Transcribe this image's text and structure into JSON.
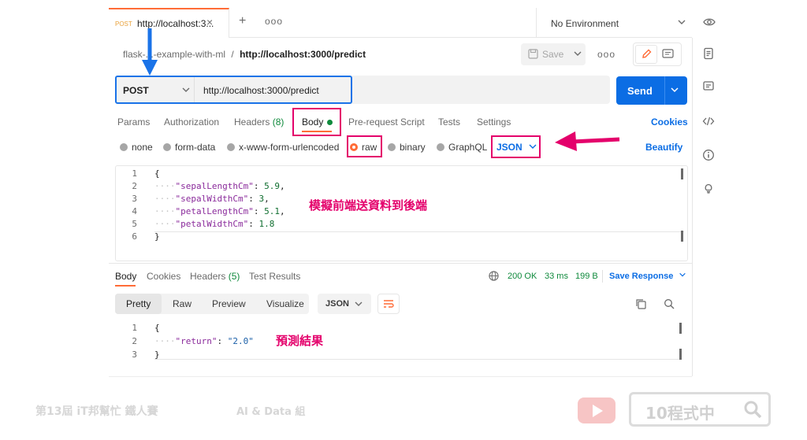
{
  "colors": {
    "accent": "#ff6c37",
    "link": "#0b6de4",
    "annotation": "#e4006b",
    "highlight_blue": "#1a73e8",
    "success": "#0f8a3c"
  },
  "tabbar": {
    "method": "POST",
    "url": "http://localhost:3...",
    "close": "×",
    "plus": "+",
    "more": "ooo"
  },
  "environment": {
    "label": "No Environment"
  },
  "breadcrumb": {
    "collection": "flask-...-example-with-ml",
    "separator": "/",
    "request": "http://localhost:3000/predict"
  },
  "toolbar": {
    "save_label": "Save",
    "more": "ooo"
  },
  "request": {
    "method": "POST",
    "url": "http://localhost:3000/predict",
    "send_label": "Send"
  },
  "request_tabs": {
    "params": "Params",
    "authorization": "Authorization",
    "headers": "Headers",
    "headers_count": "(8)",
    "body": "Body",
    "prerequest": "Pre-request Script",
    "tests": "Tests",
    "settings": "Settings",
    "cookies": "Cookies"
  },
  "body_types": {
    "none": "none",
    "form_data": "form-data",
    "urlencoded": "x-www-form-urlencoded",
    "raw": "raw",
    "binary": "binary",
    "graphql": "GraphQL",
    "format": "JSON",
    "beautify": "Beautify"
  },
  "request_body": {
    "lines": [
      {
        "n": "1",
        "text": "{"
      },
      {
        "n": "2",
        "key": "\"sepalLengthCm\"",
        "value": "5.9",
        "sep": ": ",
        "end": ","
      },
      {
        "n": "3",
        "key": "\"sepalWidthCm\"",
        "value": "3",
        "sep": ": ",
        "end": ","
      },
      {
        "n": "4",
        "key": "\"petalLengthCm\"",
        "value": "5.1",
        "sep": ": ",
        "end": ","
      },
      {
        "n": "5",
        "key": "\"petalWidthCm\"",
        "value": "1.8",
        "sep": ": ",
        "end": ""
      },
      {
        "n": "6",
        "text": "}"
      }
    ]
  },
  "annotations": {
    "simulate": "模擬前端送資料到後端",
    "result": "預測結果"
  },
  "response_tabs": {
    "body": "Body",
    "cookies": "Cookies",
    "headers": "Headers",
    "headers_count": "(5)",
    "test_results": "Test Results"
  },
  "response_meta": {
    "status": "200 OK",
    "time": "33 ms",
    "size": "199 B",
    "save_response": "Save Response"
  },
  "response_formats": {
    "pretty": "Pretty",
    "raw": "Raw",
    "preview": "Preview",
    "visualize": "Visualize",
    "format": "JSON"
  },
  "response_body": {
    "lines": [
      {
        "n": "1",
        "text": "{"
      },
      {
        "n": "2",
        "key": "\"return\"",
        "sep": ": ",
        "value": "\"2.0\""
      },
      {
        "n": "3",
        "text": "}"
      }
    ]
  },
  "footer": {
    "event": "第13屆 iT邦幫忙 鐵人賽",
    "group": "AI & Data 組",
    "brand": "10程式中"
  }
}
